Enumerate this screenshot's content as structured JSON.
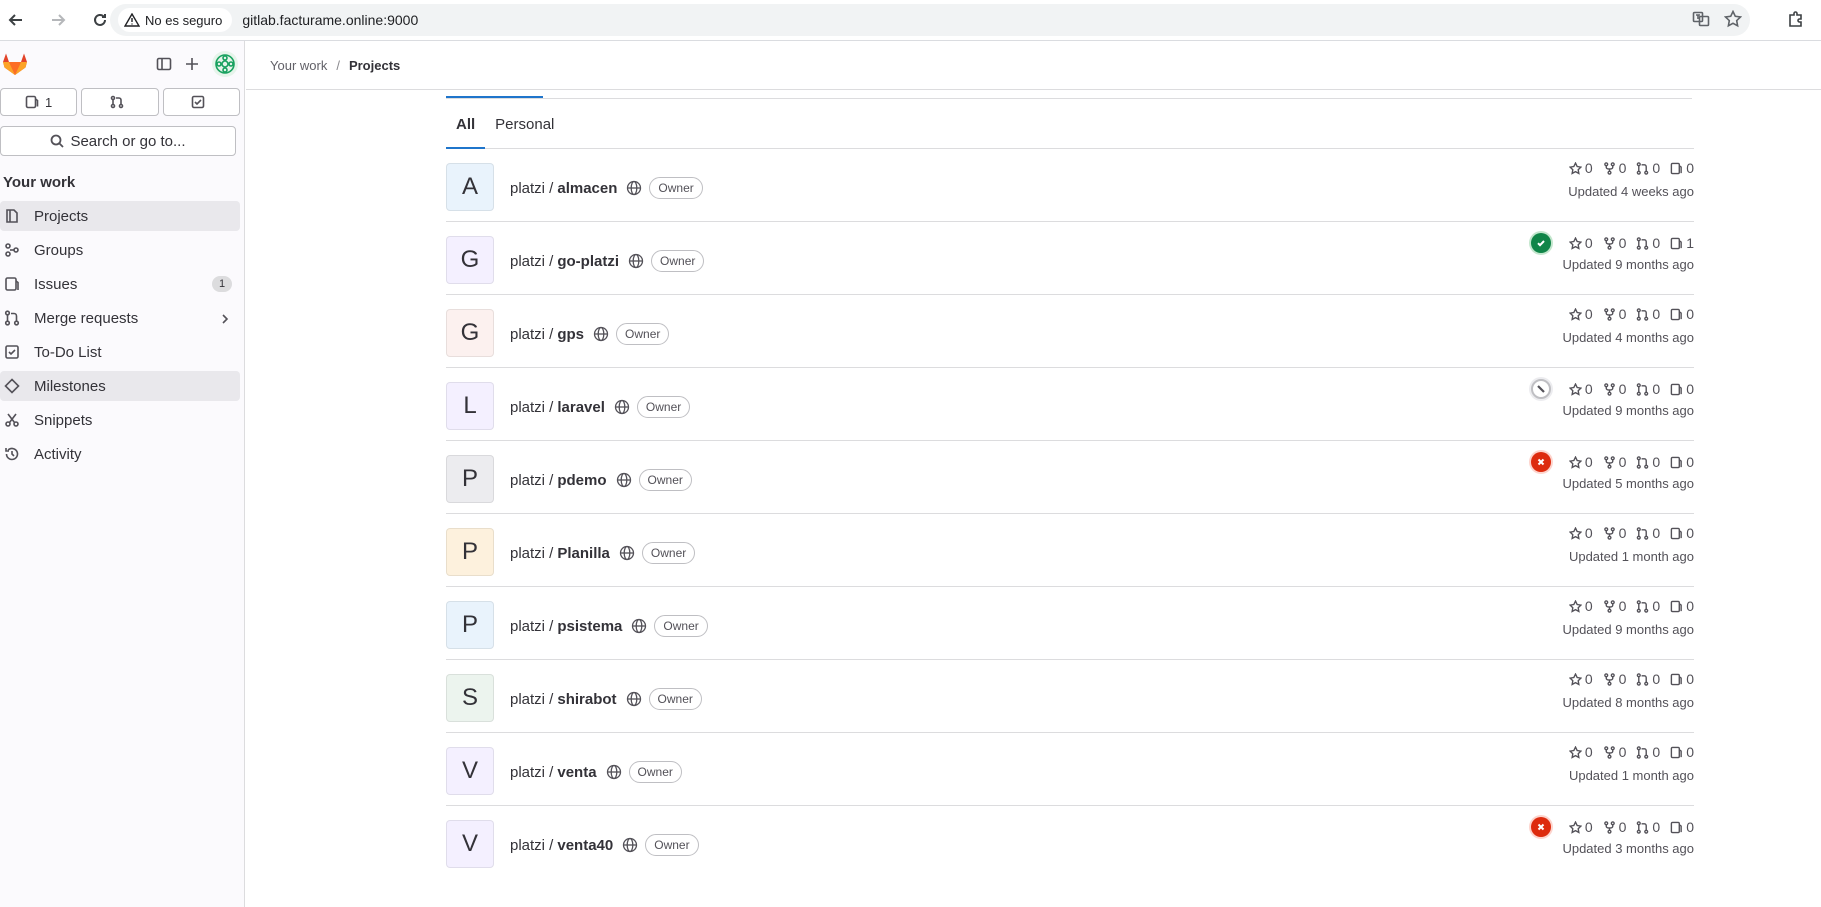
{
  "browser": {
    "security_label": "No es seguro",
    "url": "gitlab.facturame.online:9000"
  },
  "sidebar": {
    "counts": {
      "issues": "1",
      "merge_requests": "",
      "todos": ""
    },
    "search_label": "Search or go to...",
    "section_title": "Your work",
    "items": [
      {
        "label": "Projects",
        "icon": "project-icon"
      },
      {
        "label": "Groups",
        "icon": "group-icon"
      },
      {
        "label": "Issues",
        "icon": "issues-icon",
        "badge": "1"
      },
      {
        "label": "Merge requests",
        "icon": "merge-request-icon"
      },
      {
        "label": "To-Do List",
        "icon": "todo-icon"
      },
      {
        "label": "Milestones",
        "icon": "milestone-icon"
      },
      {
        "label": "Snippets",
        "icon": "snippet-icon"
      },
      {
        "label": "Activity",
        "icon": "history-icon"
      }
    ]
  },
  "breadcrumb": {
    "root": "Your work",
    "sep": "/",
    "current": "Projects"
  },
  "tabs": {
    "all": "All",
    "personal": "Personal"
  },
  "projects": [
    {
      "initial": "A",
      "ns": "platzi /",
      "name": "almacen",
      "role": "Owner",
      "stars": "0",
      "forks": "0",
      "mrs": "0",
      "issues": "0",
      "updated": "Updated 4 weeks ago",
      "pipeline": "none",
      "color": "#e9f3fc"
    },
    {
      "initial": "G",
      "ns": "platzi /",
      "name": "go-platzi",
      "role": "Owner",
      "stars": "0",
      "forks": "0",
      "mrs": "0",
      "issues": "1",
      "updated": "Updated 9 months ago",
      "pipeline": "success",
      "color": "#f4f0ff"
    },
    {
      "initial": "G",
      "ns": "platzi /",
      "name": "gps",
      "role": "Owner",
      "stars": "0",
      "forks": "0",
      "mrs": "0",
      "issues": "0",
      "updated": "Updated 4 months ago",
      "pipeline": "none",
      "color": "#fcf1ef"
    },
    {
      "initial": "L",
      "ns": "platzi /",
      "name": "laravel",
      "role": "Owner",
      "stars": "0",
      "forks": "0",
      "mrs": "0",
      "issues": "0",
      "updated": "Updated 9 months ago",
      "pipeline": "skipped",
      "color": "#f4f0ff"
    },
    {
      "initial": "P",
      "ns": "platzi /",
      "name": "pdemo",
      "role": "Owner",
      "stars": "0",
      "forks": "0",
      "mrs": "0",
      "issues": "0",
      "updated": "Updated 5 months ago",
      "pipeline": "failed",
      "color": "#ececef"
    },
    {
      "initial": "P",
      "ns": "platzi /",
      "name": "Planilla",
      "role": "Owner",
      "stars": "0",
      "forks": "0",
      "mrs": "0",
      "issues": "0",
      "updated": "Updated 1 month ago",
      "pipeline": "none",
      "color": "#fdf1dd"
    },
    {
      "initial": "P",
      "ns": "platzi /",
      "name": "psistema",
      "role": "Owner",
      "stars": "0",
      "forks": "0",
      "mrs": "0",
      "issues": "0",
      "updated": "Updated 9 months ago",
      "pipeline": "none",
      "color": "#e9f3fc"
    },
    {
      "initial": "S",
      "ns": "platzi /",
      "name": "shirabot",
      "role": "Owner",
      "stars": "0",
      "forks": "0",
      "mrs": "0",
      "issues": "0",
      "updated": "Updated 8 months ago",
      "pipeline": "none",
      "color": "#ecf4ee"
    },
    {
      "initial": "V",
      "ns": "platzi /",
      "name": "venta",
      "role": "Owner",
      "stars": "0",
      "forks": "0",
      "mrs": "0",
      "issues": "0",
      "updated": "Updated 1 month ago",
      "pipeline": "none",
      "color": "#f4f0ff"
    },
    {
      "initial": "V",
      "ns": "platzi /",
      "name": "venta40",
      "role": "Owner",
      "stars": "0",
      "forks": "0",
      "mrs": "0",
      "issues": "0",
      "updated": "Updated 3 months ago",
      "pipeline": "failed",
      "color": "#f4f0ff"
    }
  ]
}
